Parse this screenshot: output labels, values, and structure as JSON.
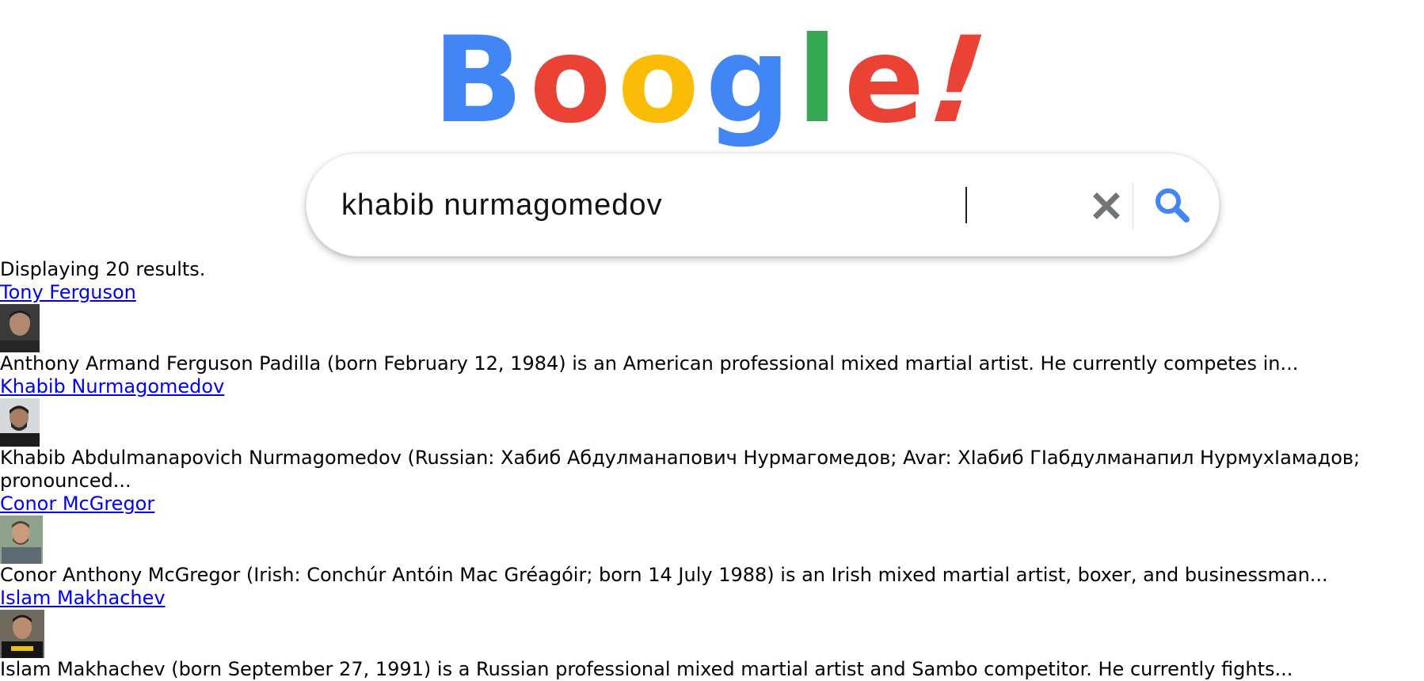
{
  "logo": {
    "letters": [
      {
        "char": "B",
        "color": "#4285f4"
      },
      {
        "char": "o",
        "color": "#ea4335"
      },
      {
        "char": "o",
        "color": "#fbbc05"
      },
      {
        "char": "g",
        "color": "#4285f4"
      },
      {
        "char": "l",
        "color": "#34a853"
      },
      {
        "char": "e",
        "color": "#ea4335"
      },
      {
        "char": "!",
        "color": "#ea4335"
      }
    ]
  },
  "search": {
    "value": "khabib nurmagomedov",
    "clear_icon": "close-icon",
    "search_icon": "search-icon",
    "icon_gray": "#70757a",
    "icon_blue": "#4285f4"
  },
  "results": {
    "count_text": "Displaying 20 results.",
    "items": [
      {
        "title": "Tony Ferguson",
        "thumbnail": "person-photo",
        "snippet": "Anthony Armand Ferguson Padilla (born February 12, 1984) is an American professional mixed martial artist. He currently competes in..."
      },
      {
        "title": "Khabib Nurmagomedov",
        "thumbnail": "person-photo",
        "snippet": "Khabib Abdulmanapovich Nurmagomedov (Russian: Хабиб Абдулманапович Нурмагомедов; Avar: ХIабиб ГIабдулманапил НурмухIамадов; pronounced..."
      },
      {
        "title": "Conor McGregor",
        "thumbnail": "person-photo",
        "snippet": "Conor Anthony McGregor (Irish: Conchúr Antóin Mac Gréagóir; born 14 July 1988) is an Irish mixed martial artist, boxer, and businessman..."
      },
      {
        "title": "Islam Makhachev",
        "thumbnail": "person-photo",
        "snippet": "Islam Makhachev (born September 27, 1991) is a Russian professional mixed martial artist and Sambo competitor. He currently fights..."
      }
    ]
  },
  "link_color": "#0000ee"
}
